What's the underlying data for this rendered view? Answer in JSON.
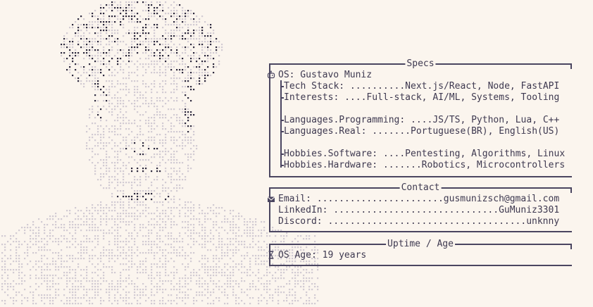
{
  "specs": {
    "title": "Specs",
    "os": "OS: Gustavo Muniz",
    "tech_stack": "Tech Stack: ..........Next.js/React, Node, FastAPI",
    "interests": "Interests: ....Full-stack, AI/ML, Systems, Tooling",
    "lang_programming": "Languages.Programming: ....JS/TS, Python, Lua, C++",
    "lang_real": "Languages.Real: .......Portuguese(BR), English(US)",
    "hobbies_software": "Hobbies.Software: ....Pentesting, Algorithms, Linux",
    "hobbies_hardware": "Hobbies.Hardware: .......Robotics, Microcontrollers"
  },
  "contact": {
    "title": "Contact",
    "email": "Email: .......................gusmunizsch@gmail.com",
    "linkedin": "LinkedIn: ..............................GuMuniz3301",
    "discord": "Discord: ....................................unknny"
  },
  "uptime": {
    "title": "Uptime / Age",
    "os_age": "OS Age: 19 years"
  },
  "icons": {
    "os": "robot-icon",
    "email": "envelope-icon",
    "uptime": "hourglass-icon"
  },
  "colors": {
    "background": "#fbf5ee",
    "text": "#3e3950",
    "ascii_light": "#d2cbd3",
    "ascii_dark": "#2e2a3f"
  }
}
